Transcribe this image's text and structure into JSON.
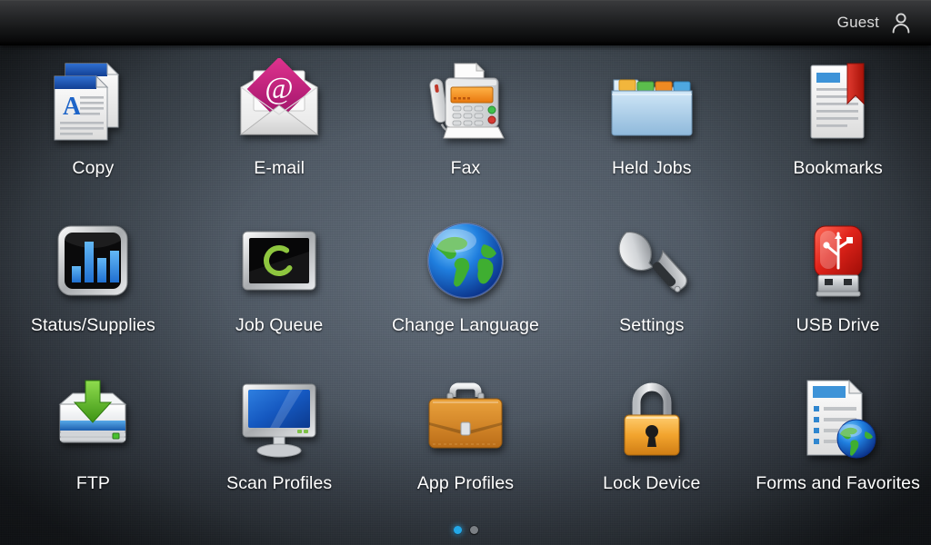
{
  "header": {
    "user_label": "Guest",
    "user_icon": "person-icon"
  },
  "theme": {
    "background": "#4b5560",
    "header_background": "#0a0a0b",
    "label_color": "#ffffff",
    "active_dot_color": "#23a8e8",
    "inactive_dot_color": "#7b7f84"
  },
  "home": {
    "tiles": [
      {
        "label": "Copy",
        "icon": "copy-documents-icon"
      },
      {
        "label": "E-mail",
        "icon": "email-envelope-at-icon"
      },
      {
        "label": "Fax",
        "icon": "fax-machine-icon"
      },
      {
        "label": "Held Jobs",
        "icon": "folder-tabs-icon"
      },
      {
        "label": "Bookmarks",
        "icon": "document-red-ribbon-icon"
      },
      {
        "label": "Status/Supplies",
        "icon": "bar-chart-screen-icon"
      },
      {
        "label": "Job Queue",
        "icon": "monitor-spinner-icon"
      },
      {
        "label": "Change Language",
        "icon": "globe-icon"
      },
      {
        "label": "Settings",
        "icon": "wrench-icon"
      },
      {
        "label": "USB Drive",
        "icon": "usb-flash-drive-icon"
      },
      {
        "label": "FTP",
        "icon": "drive-download-arrow-icon"
      },
      {
        "label": "Scan Profiles",
        "icon": "desktop-monitor-icon"
      },
      {
        "label": "App Profiles",
        "icon": "briefcase-icon"
      },
      {
        "label": "Lock Device",
        "icon": "padlock-icon"
      },
      {
        "label": "Forms and Favorites",
        "icon": "document-list-globe-icon"
      }
    ]
  },
  "pager": {
    "pages": 2,
    "current_page": 1
  }
}
